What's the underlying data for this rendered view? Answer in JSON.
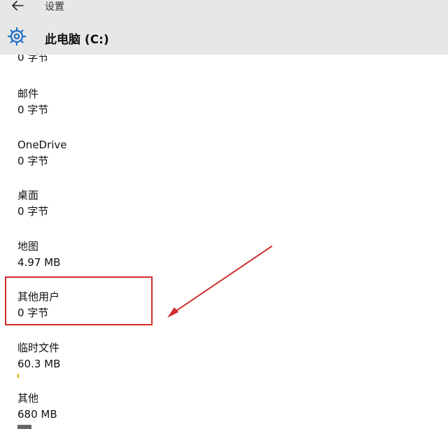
{
  "header": {
    "back_icon": "back-arrow-icon",
    "app_title": "设置",
    "settings_icon": "gear-icon",
    "page_title": "此电脑 (C:)"
  },
  "storage": {
    "cut_off_size": "0 字节",
    "items": [
      {
        "name": "邮件",
        "size": "0 字节"
      },
      {
        "name": "OneDrive",
        "size": "0 字节"
      },
      {
        "name": "桌面",
        "size": "0 字节"
      },
      {
        "name": "地图",
        "size": "4.97 MB"
      },
      {
        "name": "其他用户",
        "size": "0 字节"
      },
      {
        "name": "临时文件",
        "size": "60.3 MB",
        "highlighted": true
      },
      {
        "name": "其他",
        "size": "680 MB"
      }
    ]
  },
  "colors": {
    "header_bg": "#e7e7e7",
    "highlight": "#d22d2d",
    "gear": "#1f6fc7",
    "bar": "#666666"
  }
}
